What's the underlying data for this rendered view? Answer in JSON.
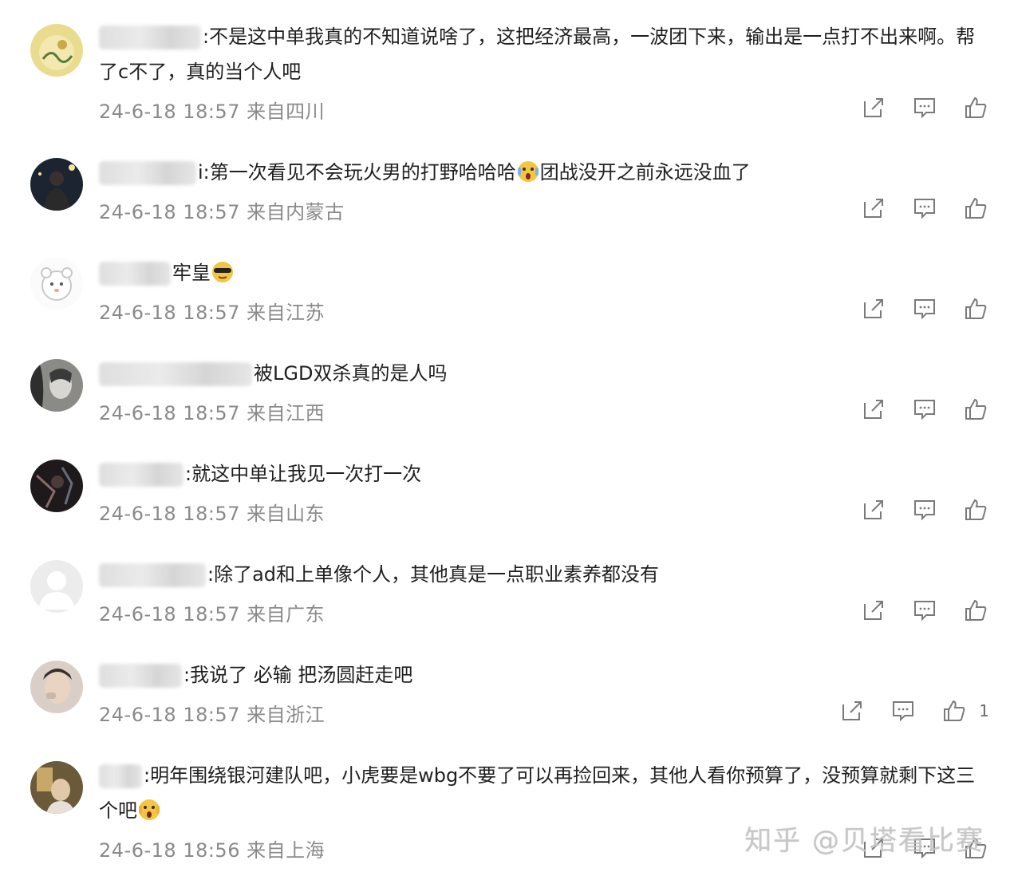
{
  "comments": [
    {
      "text": ":不是这中单我真的不知道说啥了，这把经济最高，一波团下来，输出是一点打不出来啊。帮了c不了，真的当个人吧",
      "time": "24-6-18 18:57",
      "location": "来自四川",
      "likes": ""
    },
    {
      "text": "i:第一次看见不会玩火男的打野哈哈哈",
      "text2": "团战没开之前永远没血了",
      "time": "24-6-18 18:57",
      "location": "来自内蒙古",
      "likes": ""
    },
    {
      "text": "牢皇",
      "time": "24-6-18 18:57",
      "location": "来自江苏",
      "likes": ""
    },
    {
      "text": "被LGD双杀真的是人吗",
      "time": "24-6-18 18:57",
      "location": "来自江西",
      "likes": ""
    },
    {
      "text": ":就这中单让我见一次打一次",
      "time": "24-6-18 18:57",
      "location": "来自山东",
      "likes": ""
    },
    {
      "text": ":除了ad和上单像个人，其他真是一点职业素养都没有",
      "time": "24-6-18 18:57",
      "location": "来自广东",
      "likes": ""
    },
    {
      "text": ":我说了 必输 把汤圆赶走吧",
      "time": "24-6-18 18:57",
      "location": "来自浙江",
      "likes": "1"
    },
    {
      "text": ":明年围绕银河建队吧，小虎要是wbg不要了可以再捡回来，其他人看你预算了，没预算就剩下这三个吧",
      "time": "24-6-18 18:56",
      "location": "来自上海",
      "likes": ""
    }
  ],
  "watermark": "知乎 @贝塔看比赛",
  "icons": {
    "share": "share-icon",
    "reply": "comment-icon",
    "like": "thumbs-up-icon"
  },
  "colors": {
    "text": "#1f1f1f",
    "meta": "#8a8a8a",
    "icon": "#7a7a7a"
  }
}
